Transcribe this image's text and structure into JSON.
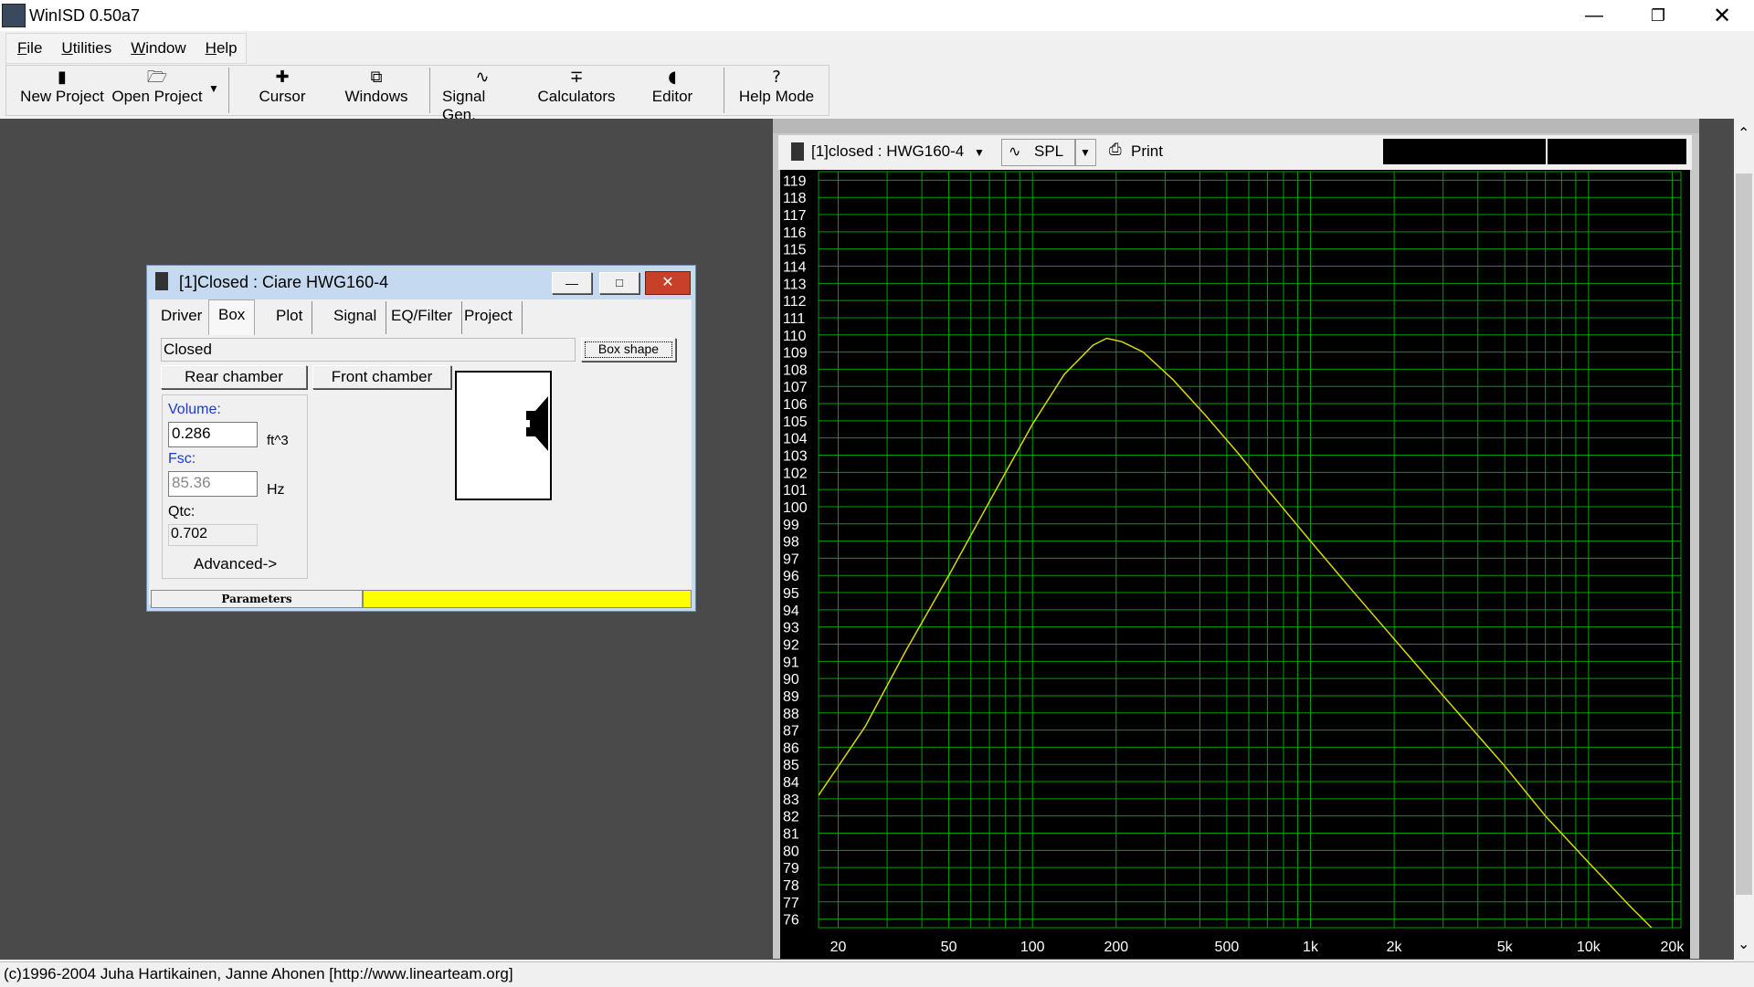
{
  "app": {
    "title": "WinISD 0.50a7"
  },
  "menu": [
    {
      "prefix": "",
      "u": "F",
      "rest": "ile"
    },
    {
      "prefix": "",
      "u": "U",
      "rest": "tilities"
    },
    {
      "prefix": "",
      "u": "W",
      "rest": "indow"
    },
    {
      "prefix": "",
      "u": "H",
      "rest": "elp"
    }
  ],
  "toolbar": {
    "new_project": "New Project",
    "open_project": "Open Project",
    "cursor": "Cursor",
    "windows": "Windows",
    "signal_gen": "Signal Gen.",
    "calculators": "Calculators",
    "editor": "Editor",
    "help_mode": "Help Mode"
  },
  "child": {
    "title": "[1]Closed : Ciare HWG160-4",
    "tabs": [
      "Driver",
      "Box",
      "Plot",
      "Signal",
      "EQ/Filter",
      "Project"
    ],
    "active_tab": "Box",
    "box_type": "Closed",
    "box_shape_button": "Box shape",
    "rear_chamber": "Rear chamber",
    "front_chamber": "Front chamber",
    "volume_label": "Volume:",
    "volume_value": "0.286",
    "volume_unit": "ft^3",
    "fsc_label": "Fsc:",
    "fsc_value": "85.36",
    "fsc_unit": "Hz",
    "qtc_label": "Qtc:",
    "qtc_value": "0.702",
    "advanced": "Advanced->",
    "status_parameters": "Parameters",
    "status_color": "#ffff00"
  },
  "plot": {
    "project_select": "[1]closed : HWG160-4",
    "graph_select": "SPL",
    "print": "Print",
    "grid_color": "#00a000",
    "curve_color": "#d8d800"
  },
  "chart_data": {
    "type": "line",
    "xscale": "log",
    "xlim": [
      17,
      21500
    ],
    "ylim": [
      75.5,
      119.5
    ],
    "yticks": [
      76,
      77,
      78,
      79,
      80,
      81,
      82,
      83,
      84,
      85,
      86,
      87,
      88,
      89,
      90,
      91,
      92,
      93,
      94,
      95,
      96,
      97,
      98,
      99,
      100,
      101,
      102,
      103,
      104,
      105,
      106,
      107,
      108,
      109,
      110,
      111,
      112,
      113,
      114,
      115,
      116,
      117,
      118,
      119
    ],
    "xticks": [
      {
        "v": 20,
        "l": "20"
      },
      {
        "v": 50,
        "l": "50"
      },
      {
        "v": 100,
        "l": "100"
      },
      {
        "v": 200,
        "l": "200"
      },
      {
        "v": 500,
        "l": "500"
      },
      {
        "v": 1000,
        "l": "1k"
      },
      {
        "v": 2000,
        "l": "2k"
      },
      {
        "v": 5000,
        "l": "5k"
      },
      {
        "v": 10000,
        "l": "10k"
      },
      {
        "v": 20000,
        "l": "20k"
      }
    ],
    "series": [
      {
        "x": [
          17,
          25,
          35,
          50,
          70,
          100,
          130,
          165,
          185,
          210,
          250,
          320,
          420,
          550,
          700,
          1000,
          1400,
          2000,
          3000,
          5000,
          7000,
          10000,
          14000,
          20000
        ],
        "y": [
          83.2,
          87.2,
          91.6,
          96.0,
          100.3,
          104.8,
          107.7,
          109.4,
          109.8,
          109.6,
          109.0,
          107.4,
          105.3,
          103.1,
          101.0,
          98.0,
          95.2,
          92.3,
          89.0,
          84.9,
          82.0,
          79.3,
          76.8,
          74.3
        ]
      }
    ]
  },
  "statusbar": {
    "text": "(c)1996-2004 Juha Hartikainen, Janne Ahonen [http://www.linearteam.org]"
  }
}
